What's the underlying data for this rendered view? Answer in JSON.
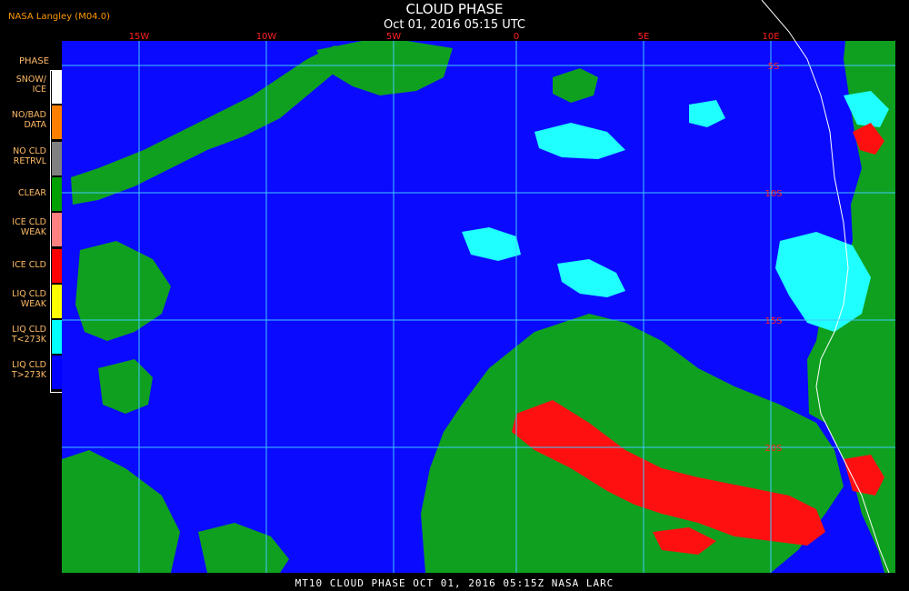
{
  "header": {
    "title": "CLOUD PHASE",
    "timestamp": "Oct 01, 2016 05:15 UTC",
    "org": "NASA Langley (M04.0)"
  },
  "legend": {
    "heading": "PHASE",
    "items": [
      {
        "label_line1": "SNOW/",
        "label_line2": "ICE",
        "color": "#ffffff"
      },
      {
        "label_line1": "NO/BAD",
        "label_line2": "DATA",
        "color": "#ff8000"
      },
      {
        "label_line1": "NO CLD",
        "label_line2": "RETRVL",
        "color": "#808080"
      },
      {
        "label_line1": "CLEAR",
        "label_line2": "",
        "color": "#00a000"
      },
      {
        "label_line1": "ICE CLD",
        "label_line2": "WEAK",
        "color": "#ff8080"
      },
      {
        "label_line1": "ICE CLD",
        "label_line2": "",
        "color": "#ff0000"
      },
      {
        "label_line1": "LIQ CLD",
        "label_line2": "WEAK",
        "color": "#ffff00"
      },
      {
        "label_line1": "LIQ CLD",
        "label_line2": "T<273K",
        "color": "#00ffff"
      },
      {
        "label_line1": "LIQ CLD",
        "label_line2": "T>273K",
        "color": "#0000ff"
      }
    ]
  },
  "map": {
    "lon_labels": [
      "15W",
      "10W",
      "5W",
      "0",
      "5E",
      "10E"
    ],
    "lat_labels": [
      "5S",
      "10S",
      "15S",
      "20S"
    ],
    "grid_color": "#3fc8ff",
    "label_color": "#ff2020",
    "ocean_color": "#0a0aff",
    "clear_color": "#10a020",
    "ice_color": "#ff1010",
    "liq_cold_color": "#20ffff"
  },
  "footer": "MT10  CLOUD PHASE  OCT 01, 2016 05:15Z  NASA LARC"
}
